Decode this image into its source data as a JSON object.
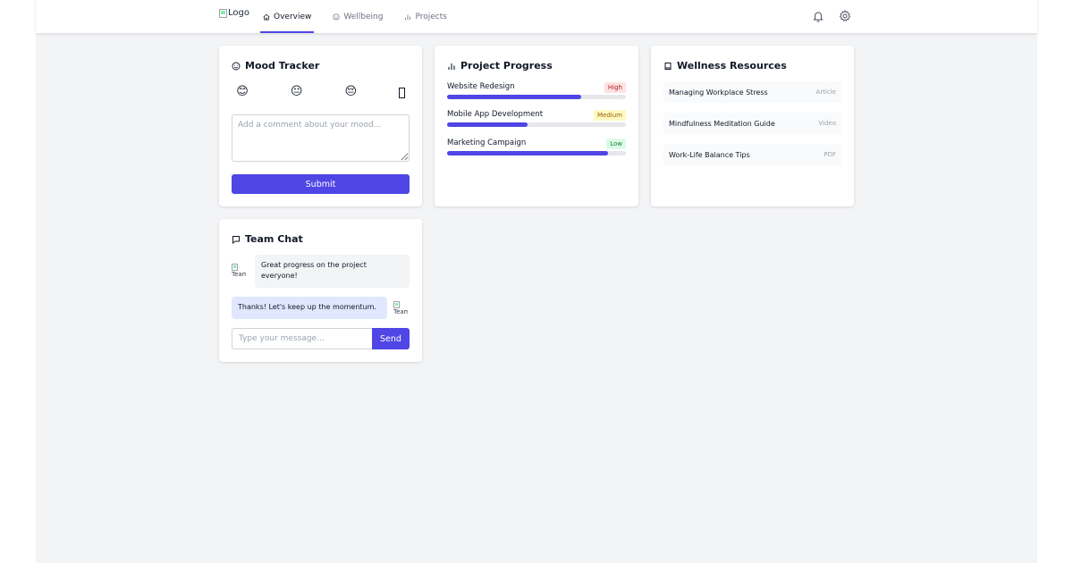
{
  "header": {
    "logo_alt": "Logo",
    "nav": [
      {
        "label": "Overview",
        "icon": "home-icon",
        "active": true
      },
      {
        "label": "Wellbeing",
        "icon": "smile-icon",
        "active": false
      },
      {
        "label": "Projects",
        "icon": "bar-chart-icon",
        "active": false
      }
    ],
    "icons": [
      "bell-icon",
      "gear-icon"
    ]
  },
  "mood": {
    "title": "Mood Tracker",
    "emojis": [
      "😊",
      "😐",
      "😔"
    ],
    "comment_placeholder": "Add a comment about your mood...",
    "submit_label": "Submit"
  },
  "projects": {
    "title": "Project Progress",
    "items": [
      {
        "name": "Website Redesign",
        "priority": "High",
        "progress": 0.75
      },
      {
        "name": "Mobile App Development",
        "priority": "Medium",
        "progress": 0.45
      },
      {
        "name": "Marketing Campaign",
        "priority": "Low",
        "progress": 0.9
      }
    ]
  },
  "resources": {
    "title": "Wellness Resources",
    "items": [
      {
        "name": "Managing Workplace Stress",
        "type": "Article"
      },
      {
        "name": "Mindfulness Meditation Guide",
        "type": "Video"
      },
      {
        "name": "Work-Life Balance Tips",
        "type": "PDF"
      }
    ]
  },
  "chat": {
    "title": "Team Chat",
    "avatar_alt": "Team",
    "messages": [
      {
        "text": "Great progress on the project everyone!",
        "side": "left"
      },
      {
        "text": "Thanks! Let's keep up the momentum.",
        "side": "right"
      }
    ],
    "input_placeholder": "Type your message...",
    "send_label": "Send"
  },
  "colors": {
    "accent": "#4f46e5",
    "high_bg": "#fee2e2",
    "high_fg": "#b91c1c",
    "medium_bg": "#fef9c3",
    "medium_fg": "#a16207",
    "low_bg": "#dcfce7",
    "low_fg": "#15803d"
  }
}
